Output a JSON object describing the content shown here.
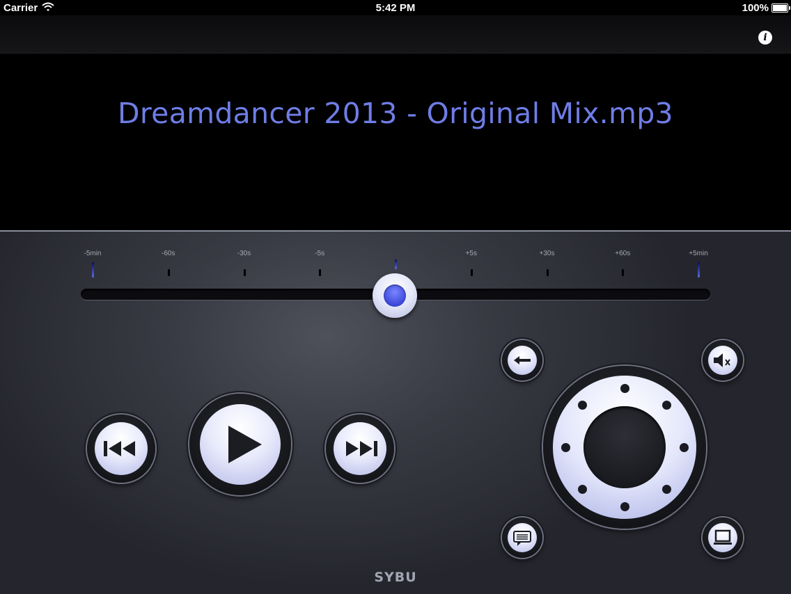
{
  "status_bar": {
    "carrier": "Carrier",
    "time": "5:42 PM",
    "battery": "100%",
    "battery_level": 1.0
  },
  "nav": {
    "info_icon": "info-icon"
  },
  "track": {
    "title": "Dreamdancer 2013 - Original Mix.mp3"
  },
  "scrubber": {
    "ticks": [
      {
        "label": "-5min",
        "style": "big"
      },
      {
        "label": "-60s",
        "style": "small"
      },
      {
        "label": "-30s",
        "style": "small"
      },
      {
        "label": "-5s",
        "style": "small"
      },
      {
        "label": "",
        "style": "center"
      },
      {
        "label": "+5s",
        "style": "small"
      },
      {
        "label": "+30s",
        "style": "small"
      },
      {
        "label": "+60s",
        "style": "small"
      },
      {
        "label": "+5min",
        "style": "big"
      }
    ],
    "position": 0.5
  },
  "controls": {
    "previous_icon": "skip-back-icon",
    "play_icon": "play-icon",
    "next_icon": "skip-forward-icon",
    "back_icon": "arrow-left-icon",
    "mute_icon": "speaker-mute-icon",
    "chat_icon": "chat-bubble-icon",
    "screen_icon": "monitor-icon",
    "dpad_icon": "directional-pad"
  },
  "brand": "SYBU",
  "colors": {
    "accent": "#6f7de6",
    "button_face": "#e4e7fb"
  }
}
